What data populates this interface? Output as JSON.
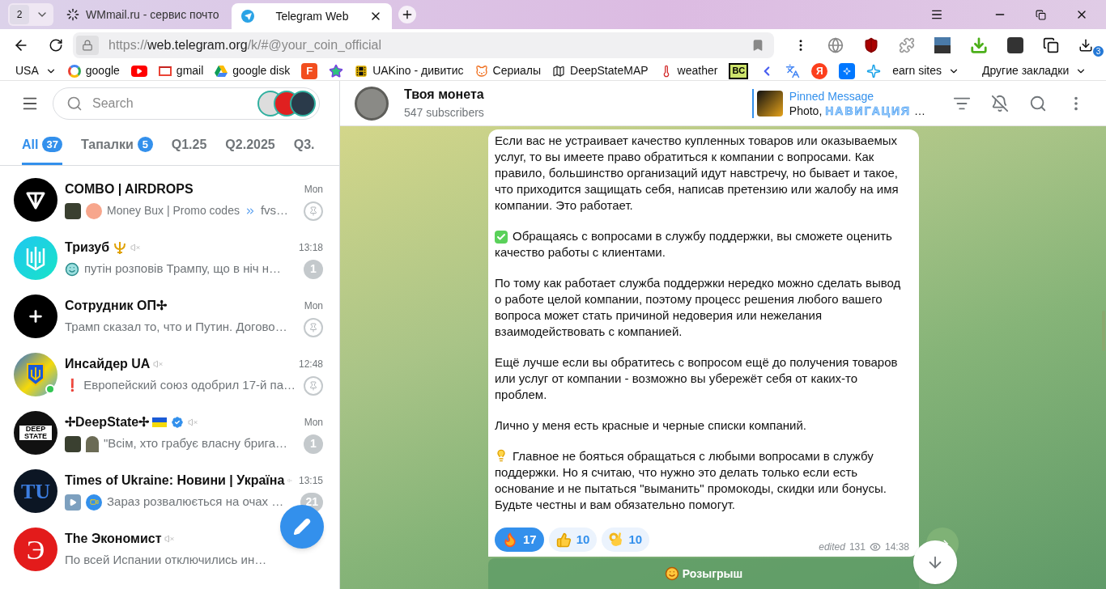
{
  "browser": {
    "tab_count": "2",
    "tabs": [
      {
        "title": "WMmail.ru - сервис почто",
        "selected": false,
        "kind": "loading"
      },
      {
        "title": "Telegram Web",
        "selected": true,
        "kind": "telegram"
      }
    ],
    "address": {
      "scheme": "https://",
      "host": "web.telegram.org",
      "path": "/k/#@your_coin_official"
    },
    "extension_badge": "3",
    "bookmarks": [
      {
        "kind": "menu",
        "label": "USA"
      },
      {
        "kind": "google",
        "label": "google"
      },
      {
        "kind": "youtube"
      },
      {
        "kind": "gmail",
        "label": "gmail"
      },
      {
        "kind": "drive",
        "label": "google disk"
      },
      {
        "kind": "square",
        "glyph": "F"
      },
      {
        "kind": "stars"
      },
      {
        "kind": "film",
        "label": "UAKino - дивитис"
      },
      {
        "kind": "cat",
        "label": "Сериалы"
      },
      {
        "kind": "map",
        "label": "DeepStateMAP"
      },
      {
        "kind": "thermometer",
        "label": "weather"
      },
      {
        "kind": "boxed",
        "glyph": "BC"
      },
      {
        "kind": "chevron"
      },
      {
        "kind": "translate"
      },
      {
        "kind": "round",
        "glyph": "Я"
      },
      {
        "kind": "vk"
      },
      {
        "kind": "sparkle"
      },
      {
        "kind": "menu",
        "label": "earn sites"
      }
    ],
    "other_bookmarks": "Другие закладки"
  },
  "sidebar": {
    "search": {
      "placeholder": "Search"
    },
    "folders": [
      {
        "label": "All",
        "badge": "37",
        "selected": true
      },
      {
        "label": "Тапалки",
        "badge": "5",
        "selected": false
      },
      {
        "label": "Q1.25",
        "selected": false
      },
      {
        "label": "Q2.2025",
        "selected": false
      },
      {
        "label": "Q3.",
        "selected": false
      }
    ],
    "chats": [
      {
        "name": "COMBO | AIRDROPS",
        "time": "Mon",
        "preview": "Money Bux | Promo codes",
        "preview_tail": "fvs…",
        "muted": false,
        "verified": false,
        "pinned": true,
        "online": false
      },
      {
        "name": "Тризуб",
        "time": "13:18",
        "preview": "путін розповів Трампу, що в ніч н…",
        "muted": true,
        "verified": false,
        "pinned": false,
        "unread": "1",
        "online": false
      },
      {
        "name": "Сотрудник ОП✢",
        "time": "Mon",
        "preview": "Трамп сказал то, что и Путин. Догово…",
        "muted": false,
        "verified": false,
        "pinned": true,
        "online": false
      },
      {
        "name": "Инсайдер UA",
        "time": "12:48",
        "preview": "❗ Европейский союз одобрил 17-й па…",
        "muted": true,
        "verified": false,
        "pinned": true,
        "online": true
      },
      {
        "avatar_text": "DEEP STATE",
        "name": "✢DeepState✢",
        "time": "Mon",
        "preview": "\"Всім, хто грабує власну брига…",
        "muted": true,
        "verified": true,
        "pinned": false,
        "unread": "1",
        "online": false
      },
      {
        "avatar_text": "TU",
        "name": "Times of Ukraine: Новини | Україна",
        "time": "13:15",
        "preview": "Зараз розвалюється на очах …",
        "muted": true,
        "verified": false,
        "pinned": false,
        "unread": "21",
        "online": false
      },
      {
        "avatar_text": "Э",
        "name": "The Экономист",
        "preview": "По всей Испании отключились ин…",
        "muted": true,
        "verified": false,
        "pinned": false,
        "online": false
      }
    ]
  },
  "chat": {
    "title": "Твоя монета",
    "subtitle": "547 subscribers",
    "pinned": {
      "label": "Pinned Message",
      "prefix": "Photo, ",
      "styled": "НАВИГАЦИЯ",
      "suffix": " …"
    },
    "message": {
      "paragraphs": [
        {
          "text": "Если вас не устраивает качество купленных товаров или оказываемых услуг, то вы имеете право обратиться к компании с вопросами. Как правило, большинство организаций идут навстречу, но бывает и такое, что приходится защищать себя, написав претензию или жалобу на имя компании. Это работает."
        },
        {
          "text": "Обращаясь с вопросами в службу поддержки, вы сможете оценить качество работы с клиентами."
        },
        {
          "text": "По тому как работает служба поддержки нередко можно сделать вывод о работе целой компании, поэтому процесс решения любого вашего вопроса может стать причиной недоверия или нежелания взаимодействовать с компанией."
        },
        {
          "text": "Ещё лучше если вы обратитесь с вопросом ещё до получения товаров или услуг от компании - возможно вы убережёт себя от каких-то проблем."
        },
        {
          "text": "Лично у меня есть красные и черные списки компаний."
        },
        {
          "text": "Главное не бояться обращаться с любыми вопросами в службу поддержки. Но я считаю, что нужно это делать только если есть основание и не пытаться \"выманить\" промокоды, скидки или бонусы. Будьте честны и вам обязательно помогут."
        }
      ],
      "reactions": [
        {
          "kind": "fire",
          "count": "17",
          "selected": true
        },
        {
          "kind": "thumbs",
          "count": "10",
          "selected": false
        },
        {
          "kind": "ok",
          "count": "10",
          "selected": false
        }
      ],
      "edited": "edited",
      "views": "131",
      "time": "14:38"
    },
    "button": {
      "label": "Розыгрыш"
    }
  }
}
